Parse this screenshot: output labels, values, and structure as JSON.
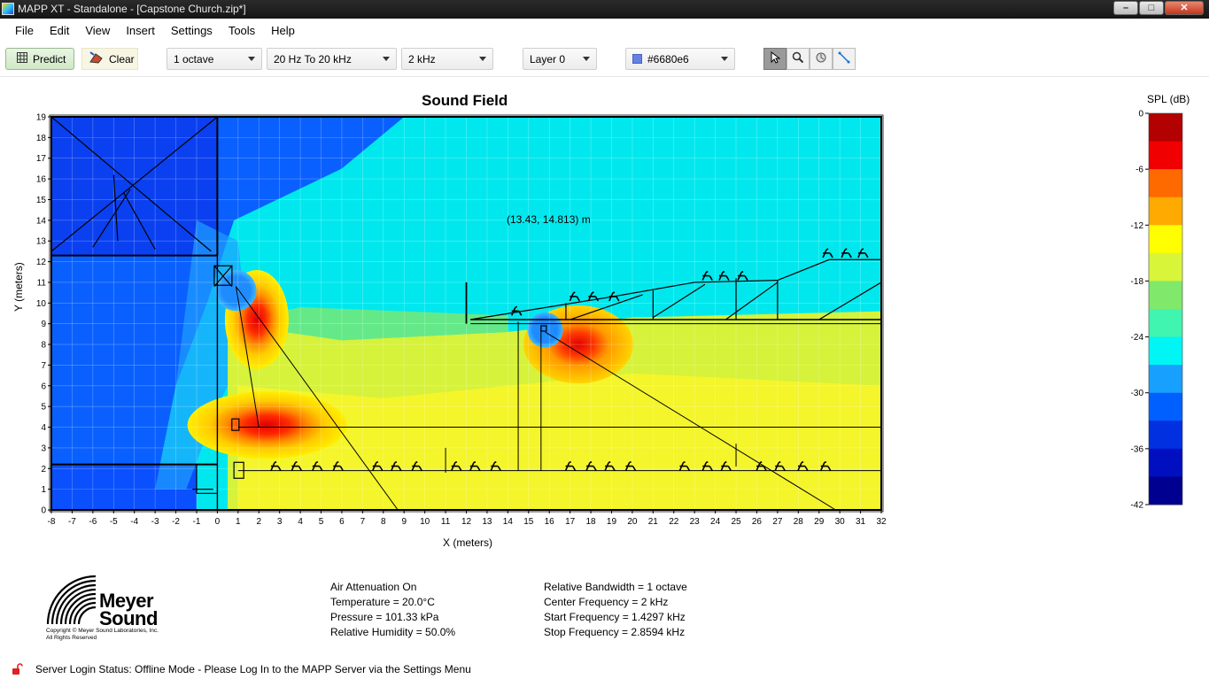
{
  "window": {
    "title": "MAPP XT - Standalone - [Capstone Church.zip*]"
  },
  "menu": [
    "File",
    "Edit",
    "View",
    "Insert",
    "Settings",
    "Tools",
    "Help"
  ],
  "toolbar": {
    "predict_label": "Predict",
    "clear_label": "Clear",
    "bandwidth": "1 octave",
    "freq_range": "20 Hz To 20 kHz",
    "center_freq": "2 kHz",
    "layer": "Layer 0",
    "color_value": "#6680e6",
    "color_hex": "#6680e6"
  },
  "plot": {
    "title": "Sound Field",
    "cursor_readout": "(13.43, 14.813)  m",
    "xlabel": "X (meters)",
    "ylabel": "Y (meters)",
    "x_ticks": [
      "-8",
      "-7",
      "-6",
      "-5",
      "-4",
      "-3",
      "-2",
      "-1",
      "0",
      "1",
      "2",
      "3",
      "4",
      "5",
      "6",
      "7",
      "8",
      "9",
      "10",
      "11",
      "12",
      "13",
      "14",
      "15",
      "16",
      "17",
      "18",
      "19",
      "20",
      "21",
      "22",
      "23",
      "24",
      "25",
      "26",
      "27",
      "28",
      "29",
      "30",
      "31",
      "32"
    ],
    "y_ticks": [
      "0",
      "1",
      "2",
      "3",
      "4",
      "5",
      "6",
      "7",
      "8",
      "9",
      "10",
      "11",
      "12",
      "13",
      "14",
      "15",
      "16",
      "17",
      "18",
      "19"
    ],
    "xlim": [
      -8,
      32
    ],
    "ylim": [
      0,
      19
    ]
  },
  "legend": {
    "title": "SPL (dB)",
    "ticks": [
      "0",
      "-6",
      "-12",
      "-18",
      "-24",
      "-30",
      "-36",
      "-42"
    ],
    "colors": [
      "#b30000",
      "#f00000",
      "#ff6a00",
      "#ffaa00",
      "#ffff00",
      "#d9f53a",
      "#80e86a",
      "#3ff5b0",
      "#00f5f5",
      "#18a0ff",
      "#0060ff",
      "#0030e0",
      "#0010c0",
      "#000090"
    ]
  },
  "logo": {
    "line1": "Meyer",
    "line2": "Sound",
    "copyright1": "Copyright © Meyer Sound Laboratories, Inc.",
    "copyright2": "All Rights Reserved"
  },
  "info_left": [
    "Air Attenuation On",
    "Temperature = 20.0°C",
    "Pressure = 101.33  kPa",
    "Relative Humidity = 50.0%"
  ],
  "info_right": [
    "Relative Bandwidth = 1 octave",
    "Center Frequency = 2 kHz",
    "Start Frequency = 1.4297 kHz",
    "Stop Frequency = 2.8594 kHz"
  ],
  "status": {
    "text": "Server Login Status: Offline Mode - Please Log In to the MAPP Server via the Settings Menu"
  }
}
